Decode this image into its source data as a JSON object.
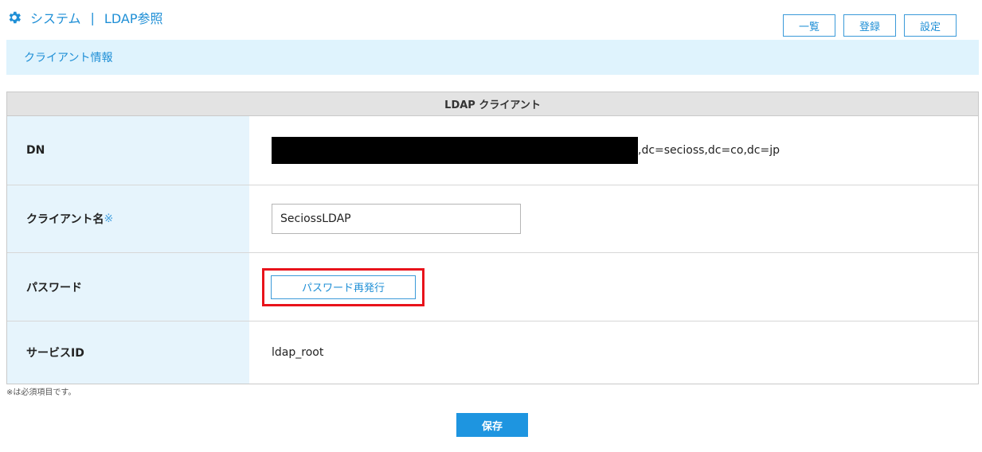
{
  "header": {
    "icon": "gear-icon",
    "section": "システム",
    "separator": "|",
    "page": "LDAP参照",
    "buttons": [
      "一覧",
      "登録",
      "設定"
    ]
  },
  "subheader": {
    "title": "クライアント情報"
  },
  "panel": {
    "title": "LDAP クライアント",
    "rows": {
      "dn": {
        "label": "DN",
        "value_suffix": ",dc=secioss,dc=co,dc=jp"
      },
      "client_name": {
        "label": "クライアント名",
        "required_mark": "※",
        "value": "SeciossLDAP"
      },
      "password": {
        "label": "パスワード",
        "button": "パスワード再発行"
      },
      "service_id": {
        "label": "サービスID",
        "value": "ldap_root"
      }
    }
  },
  "note": "※は必須項目です。",
  "save_label": "保存",
  "colors": {
    "accent": "#1f8fd6",
    "highlight": "#e8131b",
    "label_bg": "#e6f4fc"
  }
}
